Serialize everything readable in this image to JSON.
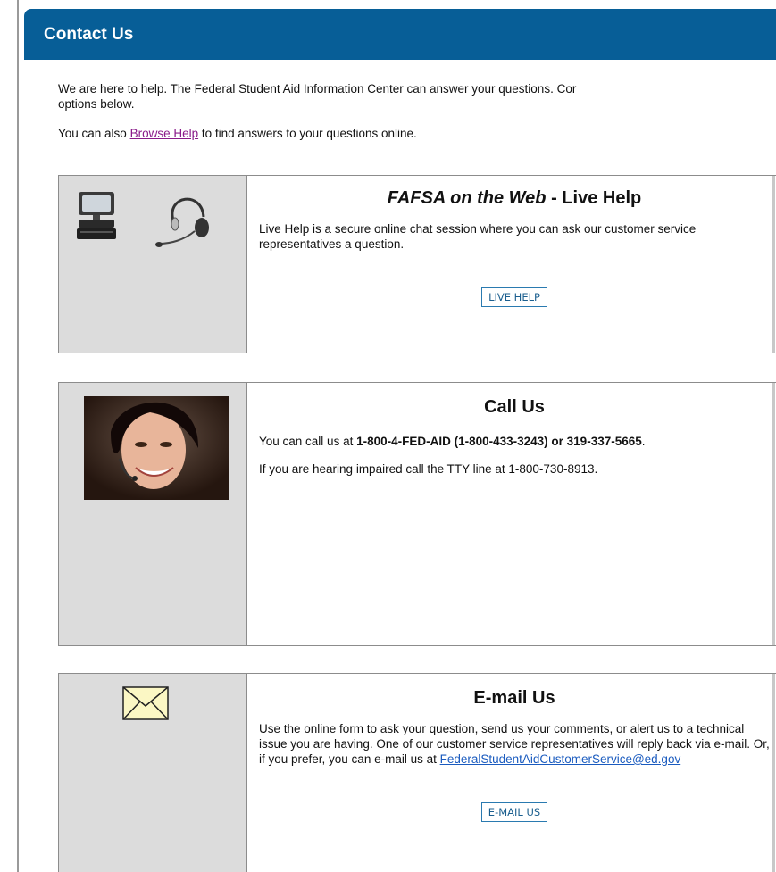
{
  "header": {
    "title": "Contact Us"
  },
  "intro": {
    "line1": "We are here to help. The Federal Student Aid Information Center can answer your questions. Cor",
    "line2": "options below.",
    "browse_prefix": "You can also ",
    "browse_link": "Browse Help",
    "browse_suffix": " to find answers to your questions online."
  },
  "live_help": {
    "title_italic": "FAFSA on the Web",
    "title_rest": " - Live Help",
    "description": "Live Help is a secure online chat session where you can ask our customer service representatives a question.",
    "button": "LIVE HELP"
  },
  "call_us": {
    "title": "Call Us",
    "line1_prefix": "You can call us at ",
    "line1_bold": "1-800-4-FED-AID (1-800-433-3243) or 319-337-5665",
    "line1_suffix": ".",
    "line2": "If you are hearing impaired call the TTY line at 1-800-730-8913."
  },
  "email_us": {
    "title": "E-mail Us",
    "description": "Use the online form to ask your question, send us your comments, or alert us to a technical issue you are having. One of our customer service representatives will reply back via e-mail. Or, if you prefer, you can e-mail us at ",
    "email": "FederalStudentAidCustomerService@ed.gov",
    "button": "E-MAIL US"
  },
  "colors": {
    "header_bg": "#075e97",
    "side_bg": "#dcdcdc",
    "link": "#1a5bbf",
    "visited_link": "#8a1b8a"
  }
}
